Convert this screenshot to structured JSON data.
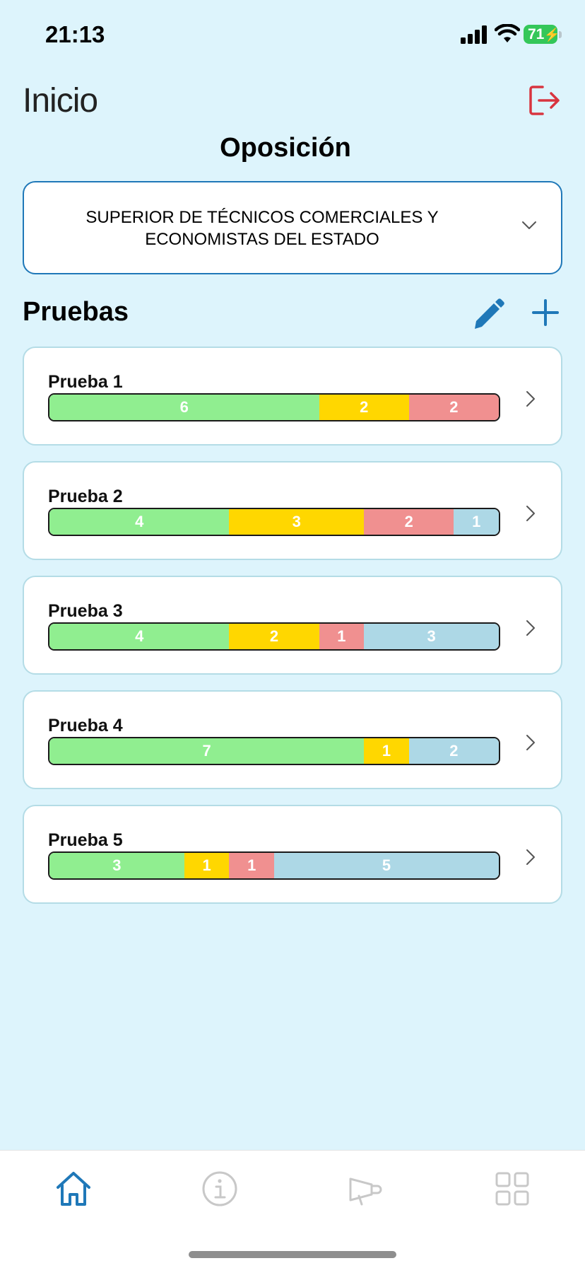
{
  "status_bar": {
    "time": "21:13",
    "battery": "71"
  },
  "header": {
    "title": "Inicio",
    "logout_icon": "logout-icon",
    "accent_color": "#d8343f"
  },
  "oposicion": {
    "heading": "Oposición",
    "selected_line1": "SUPERIOR DE TÉCNICOS COMERCIALES Y",
    "selected_line2": "ECONOMISTAS DEL ESTADO"
  },
  "pruebas": {
    "title": "Pruebas",
    "edit_icon": "pencil-icon",
    "add_icon": "plus-icon",
    "segment_colors": {
      "green": "#90ee90",
      "yellow": "#ffd700",
      "red": "#f09090",
      "blue": "#add8e6"
    },
    "items": [
      {
        "label": "Prueba 1",
        "segments": [
          {
            "color": "green",
            "value": "6"
          },
          {
            "color": "yellow",
            "value": "2"
          },
          {
            "color": "red",
            "value": "2"
          }
        ]
      },
      {
        "label": "Prueba 2",
        "segments": [
          {
            "color": "green",
            "value": "4"
          },
          {
            "color": "yellow",
            "value": "3"
          },
          {
            "color": "red",
            "value": "2"
          },
          {
            "color": "blue",
            "value": "1"
          }
        ]
      },
      {
        "label": "Prueba 3",
        "segments": [
          {
            "color": "green",
            "value": "4"
          },
          {
            "color": "yellow",
            "value": "2"
          },
          {
            "color": "red",
            "value": "1"
          },
          {
            "color": "blue",
            "value": "3"
          }
        ]
      },
      {
        "label": "Prueba 4",
        "segments": [
          {
            "color": "green",
            "value": "7"
          },
          {
            "color": "yellow",
            "value": "1"
          },
          {
            "color": "blue",
            "value": "2"
          }
        ]
      },
      {
        "label": "Prueba 5",
        "segments": [
          {
            "color": "green",
            "value": "3"
          },
          {
            "color": "yellow",
            "value": "1"
          },
          {
            "color": "red",
            "value": "1"
          },
          {
            "color": "blue",
            "value": "5"
          }
        ]
      }
    ]
  },
  "tab_bar": {
    "active_color": "#1f78b8",
    "inactive_color": "#c8c8c8",
    "tabs": [
      {
        "icon": "home-icon",
        "active": true
      },
      {
        "icon": "info-icon",
        "active": false
      },
      {
        "icon": "megaphone-icon",
        "active": false
      },
      {
        "icon": "grid-icon",
        "active": false
      }
    ]
  }
}
